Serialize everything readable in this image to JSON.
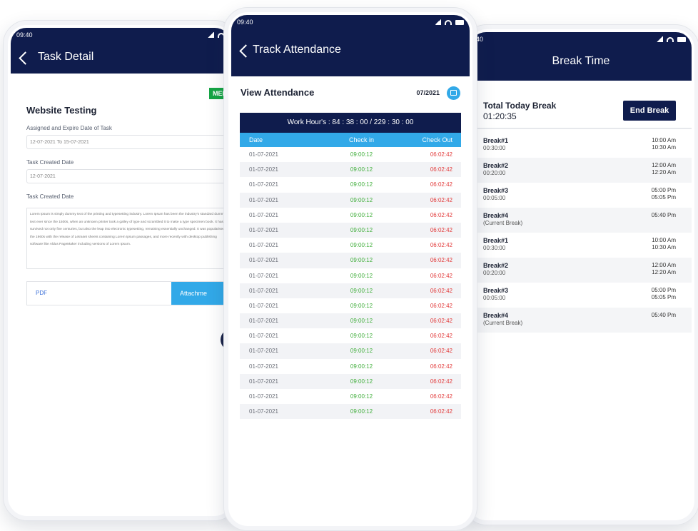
{
  "task_detail": {
    "status_time": "09:40",
    "title": "Task Detail",
    "priority_badge": "MED",
    "task_name": "Website Testing",
    "assigned_label": "Assigned and Expire Date of Task",
    "assigned_value": "12-07-2021 To 15-07-2021",
    "created_label": "Task Created Date",
    "created_value": "12-07-2021",
    "description_label": "Task Created Date",
    "description_text": "Lorem Ipsum is simply dummy text of the printing and typesetting industry. Lorem Ipsum has been the industry's standard dummy text ever since the 1500s, when an unknown printer took a galley of type and scrambled it to make a type specimen book. It has survived not only five centuries, but also the leap into electronic typesetting, remaining essentially unchanged. It was popularised in the 1960s with the release of Letraset sheets containing Lorem Ipsum passages, and more recently with desktop publishing software like Aldus PageMaker including versions of Lorem Ipsum.",
    "tab_pdf": "PDF",
    "tab_attachment": "Attachme"
  },
  "track_attendance": {
    "status_time": "09:40",
    "title": "Track Attendance",
    "subtitle": "View Attendance",
    "month": "07/2021",
    "work_hours": "Work Hour's : 84 : 38 : 00 / 229 : 30 : 00",
    "columns": [
      "Date",
      "Check in",
      "Check Out"
    ],
    "rows": [
      {
        "date": "01-07-2021",
        "in": "09:00:12",
        "out": "06:02:42"
      },
      {
        "date": "01-07-2021",
        "in": "09:00:12",
        "out": "06:02:42"
      },
      {
        "date": "01-07-2021",
        "in": "09:00:12",
        "out": "06:02:42"
      },
      {
        "date": "01-07-2021",
        "in": "09:00:12",
        "out": "06:02:42"
      },
      {
        "date": "01-07-2021",
        "in": "09:00:12",
        "out": "06:02:42"
      },
      {
        "date": "01-07-2021",
        "in": "09:00:12",
        "out": "06:02:42"
      },
      {
        "date": "01-07-2021",
        "in": "09:00:12",
        "out": "06:02:42"
      },
      {
        "date": "01-07-2021",
        "in": "09:00:12",
        "out": "06:02:42"
      },
      {
        "date": "01-07-2021",
        "in": "09:00:12",
        "out": "06:02:42"
      },
      {
        "date": "01-07-2021",
        "in": "09:00:12",
        "out": "06:02:42"
      },
      {
        "date": "01-07-2021",
        "in": "09:00:12",
        "out": "06:02:42"
      },
      {
        "date": "01-07-2021",
        "in": "09:00:12",
        "out": "06:02:42"
      },
      {
        "date": "01-07-2021",
        "in": "09:00:12",
        "out": "06:02:42"
      },
      {
        "date": "01-07-2021",
        "in": "09:00:12",
        "out": "06:02:42"
      },
      {
        "date": "01-07-2021",
        "in": "09:00:12",
        "out": "06:02:42"
      },
      {
        "date": "01-07-2021",
        "in": "09:00:12",
        "out": "06:02:42"
      },
      {
        "date": "01-07-2021",
        "in": "09:00:12",
        "out": "06:02:42"
      },
      {
        "date": "01-07-2021",
        "in": "09:00:12",
        "out": "06:02:42"
      }
    ]
  },
  "break_time": {
    "status_time": "40",
    "title": "Break Time",
    "total_label": "Total Today Break",
    "total_value": "01:20:35",
    "end_button": "End Break",
    "breaks": [
      {
        "name": "Break#1",
        "duration": "00:30:00",
        "start": "10:00 Am",
        "end": "10:30 Am"
      },
      {
        "name": "Break#2",
        "duration": "00:20:00",
        "start": "12:00 Am",
        "end": "12:20 Am"
      },
      {
        "name": "Break#3",
        "duration": "00:05:00",
        "start": "05:00 Pm",
        "end": "05:05 Pm"
      },
      {
        "name": "Break#4",
        "duration": "(Current Break)",
        "start": "05:40 Pm",
        "end": ""
      },
      {
        "name": "Break#1",
        "duration": "00:30:00",
        "start": "10:00 Am",
        "end": "10:30 Am"
      },
      {
        "name": "Break#2",
        "duration": "00:20:00",
        "start": "12:00 Am",
        "end": "12:20 Am"
      },
      {
        "name": "Break#3",
        "duration": "00:05:00",
        "start": "05:00 Pm",
        "end": "05:05 Pm"
      },
      {
        "name": "Break#4",
        "duration": "(Current Break)",
        "start": "05:40 Pm",
        "end": ""
      }
    ]
  },
  "colors": {
    "navy": "#0f1c4d",
    "accent_blue": "#32a9e8",
    "check_in_green": "#3fae3a",
    "check_out_red": "#e23a3a",
    "badge_green": "#15a544"
  }
}
